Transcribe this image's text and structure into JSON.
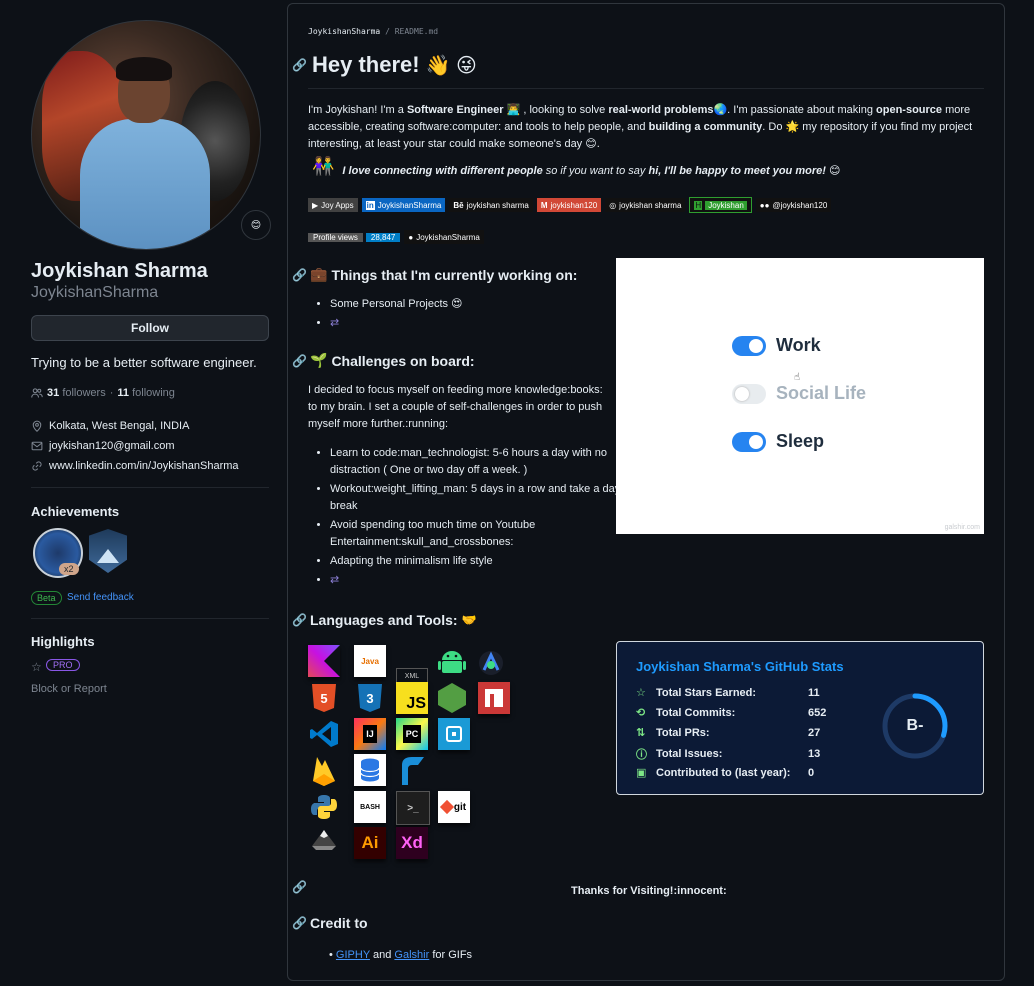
{
  "profile": {
    "full_name": "Joykishan Sharma",
    "login": "JoykishanSharma",
    "status_emoji": "😊",
    "follow_label": "Follow",
    "bio": "Trying to be a better software engineer.",
    "followers_count": "31",
    "followers_label": "followers",
    "dot": "·",
    "following_count": "11",
    "following_label": "following",
    "location": "Kolkata, West Bengal, INDIA",
    "email": "joykishan120@gmail.com",
    "website": "www.linkedin.com/in/JoykishanSharma",
    "achievements_title": "Achievements",
    "achievement_multiplier": "x2",
    "beta_label": "Beta",
    "feedback_label": "Send feedback",
    "highlights_title": "Highlights",
    "pro_label": "PRO",
    "block_label": "Block or Report"
  },
  "readme": {
    "breadcrumb_user": "JoykishanSharma",
    "breadcrumb_sep": "/",
    "breadcrumb_file": "README.md",
    "title": "Hey there!",
    "title_emoji": "👋 😜",
    "intro_1": "I'm Joykishan! I'm a ",
    "intro_2": "Software Engineer",
    "intro_3": " 👨‍💻 , looking to solve ",
    "intro_4": "real-world problems",
    "intro_5": "🌏. I'm passionate about making ",
    "intro_6": "open-source",
    "intro_7": " more accessible, creating software:computer: and tools to help people, and ",
    "intro_8": "building a community",
    "intro_9": ". Do 🌟 my repository if you find my project interesting, at least your star could make someone's day 😊.",
    "connect_emoji": "👫",
    "connect_1": "I love connecting with different people",
    "connect_2": " so if you want to say ",
    "connect_3": "hi, I'll be happy to meet you more!",
    "connect_4": " 😊",
    "badges": [
      {
        "label": "Joy Apps",
        "color": "#414141"
      },
      {
        "label": "JoykishanSharma",
        "color": "#0a66c2"
      },
      {
        "label": "joykishan sharma",
        "color": "#111111"
      },
      {
        "label": "joykishan120",
        "color": "#d14836"
      },
      {
        "label": "joykishan sharma",
        "color": "#111111"
      },
      {
        "label": "Joykishan",
        "color": "#2f9e2f"
      },
      {
        "label": "@joykishan120",
        "color": "#111111"
      }
    ],
    "profile_views_label": "Profile views",
    "profile_views_value": "28,847",
    "github_badge": "JoykishanSharma",
    "working_title": "Things that I'm currently working on:",
    "working_emoji": "💼",
    "working_items": [
      "Some Personal Projects 😍"
    ],
    "challenges_title": "Challenges on board:",
    "challenges_emoji": "🌱",
    "challenges_intro": "I decided to focus myself on feeding more knowledge:books: to my brain. I set a couple of self-challenges in order to push myself more further.:running:",
    "challenge_items": [
      "Learn to code:man_technologist: 5-6 hours a day with no distraction ( One or two day off a week. )",
      "Workout:weight_lifting_man: 5 days in a row and take a day break",
      "Avoid spending too much time on Youtube Entertainment:skull_and_crossbones:",
      "Adapting the minimalism life style"
    ],
    "languages_title": "Languages and Tools:",
    "gif": {
      "toggles": [
        {
          "label": "Work",
          "on": true
        },
        {
          "label": "Social Life",
          "on": false
        },
        {
          "label": "Sleep",
          "on": true
        }
      ],
      "credit": "galshir.com"
    },
    "stats": {
      "title": "Joykishan Sharma's GitHub Stats",
      "rows": [
        {
          "label": "Total Stars Earned:",
          "value": "11",
          "icon": "☆"
        },
        {
          "label": "Total Commits:",
          "value": "652",
          "icon": "⟲"
        },
        {
          "label": "Total PRs:",
          "value": "27",
          "icon": "⇅"
        },
        {
          "label": "Total Issues:",
          "value": "13",
          "icon": "ⓘ"
        },
        {
          "label": "Contributed to (last year):",
          "value": "0",
          "icon": "▣"
        }
      ],
      "grade": "B-",
      "ring_fraction": 0.3,
      "accent": "#1e9bff"
    },
    "tools": {
      "xml_alt": "XML",
      "html5": "5",
      "css3": "3",
      "js": "JS",
      "intellij": "IJ",
      "pycharm": "PC",
      "bash": "BASH",
      "terminal": ">_",
      "git": "git",
      "ai": "Ai",
      "xd": "Xd",
      "java": "Java"
    },
    "thanks": "Thanks for Visiting!:innocent:",
    "credit_title": "Credit to",
    "credit_link1": "GIPHY",
    "credit_and": " and ",
    "credit_link2": "Galshir",
    "credit_rest": " for GIFs"
  }
}
